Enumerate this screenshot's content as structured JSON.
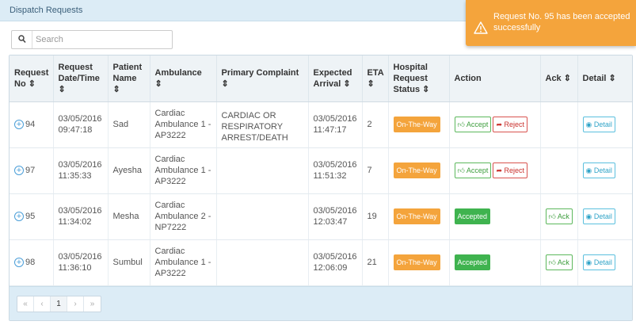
{
  "header": {
    "title": "Dispatch Requests"
  },
  "toast": {
    "message": "Request No. 95 has been accepted successfully",
    "color": "#f4a43c"
  },
  "search": {
    "placeholder": "Search",
    "value": ""
  },
  "table": {
    "columns": [
      "Request No ⇕",
      "Request Date/Time ⇕",
      "Patient Name ⇕",
      "Ambulance ⇕",
      "Primary Complaint ⇕",
      "Expected Arrival ⇕",
      "ETA ⇕",
      "Hospital Request Status ⇕",
      "Action",
      "Ack ⇕",
      "Detail ⇕"
    ],
    "rows": [
      {
        "request_no": "94",
        "datetime": "03/05/2016 09:47:18",
        "patient": "Sad",
        "ambulance": "Cardiac Ambulance 1 - AP3222",
        "complaint": "CARDIAC OR RESPIRATORY ARREST/DEATH",
        "expected": "03/05/2016 11:47:17",
        "eta": "2",
        "status": "On-The-Way",
        "accept_label": "Accept",
        "reject_label": "Reject",
        "detail_label": "Detail"
      },
      {
        "request_no": "97",
        "datetime": "03/05/2016 11:35:33",
        "patient": "Ayesha",
        "ambulance": "Cardiac Ambulance 1 - AP3222",
        "complaint": "",
        "expected": "03/05/2016 11:51:32",
        "eta": "7",
        "status": "On-The-Way",
        "accept_label": "Accept",
        "reject_label": "Reject",
        "detail_label": "Detail"
      },
      {
        "request_no": "95",
        "datetime": "03/05/2016 11:34:02",
        "patient": "Mesha",
        "ambulance": "Cardiac Ambulance 2 - NP7222",
        "complaint": "",
        "expected": "03/05/2016 12:03:47",
        "eta": "19",
        "status": "On-The-Way",
        "action_status": "Accepted",
        "ack_label": "Ack",
        "detail_label": "Detail"
      },
      {
        "request_no": "98",
        "datetime": "03/05/2016 11:36:10",
        "patient": "Sumbul",
        "ambulance": "Cardiac Ambulance 1 - AP3222",
        "complaint": "",
        "expected": "03/05/2016 12:06:09",
        "eta": "21",
        "status": "On-The-Way",
        "action_status": "Accepted",
        "ack_label": "Ack",
        "detail_label": "Detail"
      }
    ]
  },
  "pagination": {
    "first": "«",
    "prev": "‹",
    "current": "1",
    "next": "›",
    "last": "»"
  },
  "icons": {
    "search": "search-icon",
    "warning": "warning-icon",
    "expand": "plus-circle-icon",
    "thumbs_up": "thumbs-up-icon",
    "reply": "share-icon",
    "eye": "eye-icon"
  },
  "colors": {
    "status_orange": "#f4a43c",
    "accepted_green": "#3fb34f",
    "header_blue": "#dcecf6"
  }
}
